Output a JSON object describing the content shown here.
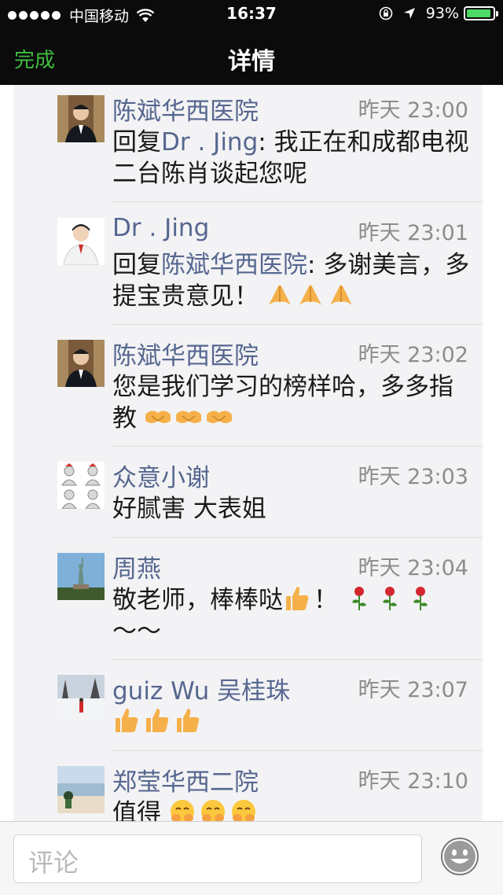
{
  "status_bar": {
    "carrier": "中国移动",
    "time": "16:37",
    "battery": "93%",
    "battery_level": 0.93
  },
  "nav": {
    "done_label": "完成",
    "title": "详情"
  },
  "comments": [
    {
      "name": "陈斌华西医院",
      "time": "昨天 23:00",
      "reply_prefix": "回复",
      "reply_to": "Dr . Jing",
      "text": ": 我正在和成都电视二台陈肖谈起您呢",
      "avatar": "man-suit-avatar"
    },
    {
      "name": "Dr . Jing",
      "time": "昨天 23:01",
      "reply_prefix": "回复",
      "reply_to": "陈斌华西医院",
      "text": ": 多谢美言，多提宝贵意见！",
      "emoji": [
        "folded-hands-emoji",
        "folded-hands-emoji",
        "folded-hands-emoji"
      ],
      "avatar": "doctor-avatar"
    },
    {
      "name": "陈斌华西医院",
      "time": "昨天 23:02",
      "text": "您是我们学习的榜样哈，多多指教",
      "emoji": [
        "handshake-emoji",
        "handshake-emoji",
        "handshake-emoji"
      ],
      "avatar": "man-suit-avatar"
    },
    {
      "name": "众意小谢",
      "time": "昨天 23:03",
      "text": "好腻害 大表姐",
      "avatar": "sketch-grid-avatar"
    },
    {
      "name": "周燕",
      "time": "昨天 23:04",
      "text": "敬老师，棒棒哒",
      "text_after": "！",
      "text_end": "～～",
      "emoji_inline": "thumbs-up-emoji",
      "emoji": [
        "rose-emoji",
        "rose-emoji",
        "rose-emoji"
      ],
      "avatar": "statue-liberty-avatar"
    },
    {
      "name": "guiz Wu 吴桂珠",
      "time": "昨天 23:07",
      "text": "",
      "emoji": [
        "thumbs-up-emoji",
        "thumbs-up-emoji",
        "thumbs-up-emoji"
      ],
      "avatar": "snow-landscape-avatar"
    },
    {
      "name": "郑莹华西二院",
      "time": "昨天 23:10",
      "text": "值得",
      "emoji": [
        "blush-hands-emoji",
        "blush-hands-emoji",
        "blush-hands-emoji"
      ],
      "avatar": "beach-avatar"
    }
  ],
  "input": {
    "placeholder": "评论"
  }
}
